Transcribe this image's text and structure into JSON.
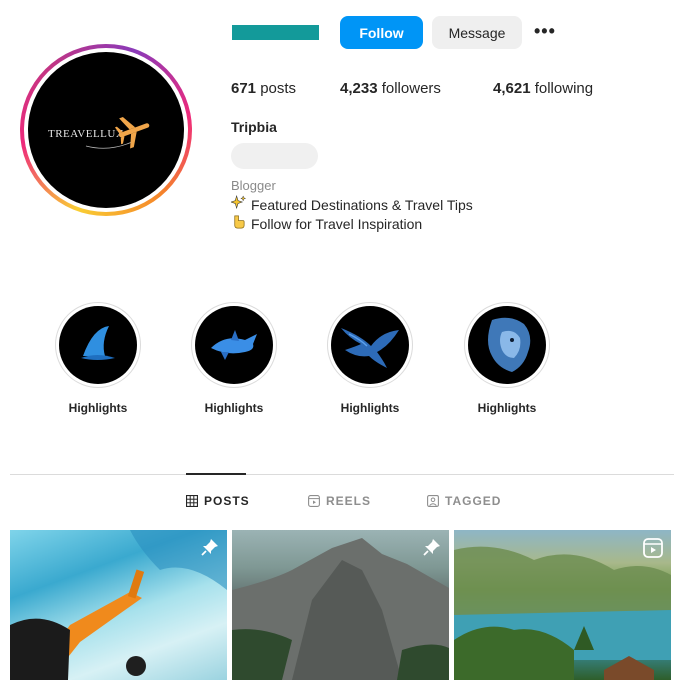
{
  "profile": {
    "follow_label": "Follow",
    "message_label": "Message",
    "more_label": "•••",
    "stats": {
      "posts_count": "671",
      "posts_label": "posts",
      "followers_count": "4,233",
      "followers_label": "followers",
      "following_count": "4,621",
      "following_label": "following"
    },
    "full_name": "Tripbia",
    "category": "Blogger",
    "bio": [
      {
        "icon": "sparkles-icon",
        "text": "Featured Destinations & Travel Tips"
      },
      {
        "icon": "pointing-hand-icon",
        "text": "Follow for Travel Inspiration"
      }
    ],
    "avatar": {
      "brand_text": "TREAVELLUX",
      "icon": "airplane-icon"
    }
  },
  "highlights": [
    {
      "label": "Highlights",
      "icon": "shark-fin-icon"
    },
    {
      "label": "Highlights",
      "icon": "shark-icon"
    },
    {
      "label": "Highlights",
      "icon": "eagle-icon"
    },
    {
      "label": "Highlights",
      "icon": "lion-icon"
    }
  ],
  "tabs": [
    {
      "label": "POSTS",
      "icon": "grid-icon",
      "active": true
    },
    {
      "label": "REELS",
      "icon": "reels-icon",
      "active": false
    },
    {
      "label": "TAGGED",
      "icon": "tagged-icon",
      "active": false
    }
  ],
  "posts": [
    {
      "icon": "pin-icon"
    },
    {
      "icon": "pin-icon"
    },
    {
      "icon": "reel-icon"
    }
  ],
  "colors": {
    "accent": "#0095f6",
    "username_redaction": "#139a9a",
    "text": "#262626",
    "muted": "#8e8e8e"
  }
}
